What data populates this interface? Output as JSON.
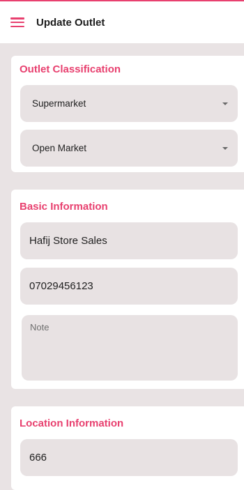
{
  "appbar": {
    "title": "Update Outlet",
    "menu_icon": "menu-icon"
  },
  "outlet_classification": {
    "title": "Outlet Classification",
    "outlet_type": "Supermarket",
    "market_type": "Open Market"
  },
  "basic_information": {
    "title": "Basic Information",
    "outlet_name": "Hafij Store Sales",
    "phone": "07029456123",
    "note_placeholder": "Note"
  },
  "location_information": {
    "title": "Location Information",
    "value": "666"
  },
  "colors": {
    "accent": "#e8406f",
    "background": "#e9e3e4",
    "field": "#e8e2e3"
  }
}
